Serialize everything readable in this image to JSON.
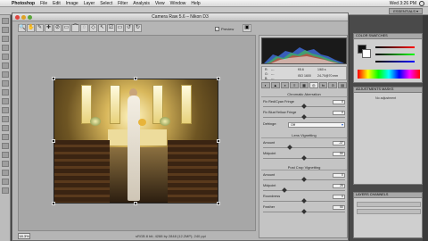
{
  "menubar": {
    "apple_glyph": "",
    "app_name": "Photoshop",
    "items": [
      "File",
      "Edit",
      "Image",
      "Layer",
      "Select",
      "Filter",
      "Analysis",
      "View",
      "Window",
      "Help"
    ],
    "clock": "Wed 3:26 PM"
  },
  "workspace": {
    "essentials_label": "ESSENTIALS ▾"
  },
  "dialog": {
    "title": "Camera Raw 5.6 – Nikon D3",
    "preview_label": "Preview",
    "preview_checked": "✓",
    "zoom_level": "18.3%",
    "status_text": "sRGB 8 bit; 4288 by 2848 (12.2MP); 240 ppi",
    "traffic_colors": [
      "#e0443e",
      "#dea123",
      "#5aa53a"
    ]
  },
  "readout": {
    "r_label": "R:",
    "g_label": "G:",
    "b_label": "B:",
    "r_value": "---",
    "g_value": "---",
    "b_value": "---",
    "f_value": "f/5.6",
    "shutter": "1/60 s",
    "iso": "ISO 1600",
    "focal": "24-70@70 mm"
  },
  "panel_tabs": [
    "◐",
    "▲",
    "◑",
    "≡",
    "▦",
    "◎",
    "fx",
    "⊙",
    "▤"
  ],
  "sections": {
    "chromatic": {
      "title": "Chromatic Aberration",
      "rows": [
        {
          "label": "Fix Red/Cyan Fringe",
          "value": "0",
          "pos": 0.5
        },
        {
          "label": "Fix Blue/Yellow Fringe",
          "value": "0",
          "pos": 0.5
        }
      ],
      "defringe_label": "Defringe:",
      "defringe_value": "Off"
    },
    "lens_vignetting": {
      "title": "Lens Vignetting",
      "rows": [
        {
          "label": "Amount",
          "value": "-37",
          "pos": 0.32
        },
        {
          "label": "Midpoint",
          "value": "50",
          "pos": 0.5
        }
      ]
    },
    "post_crop": {
      "title": "Post Crop Vignetting",
      "rows": [
        {
          "label": "Amount",
          "value": "0",
          "pos": 0.5
        },
        {
          "label": "Midpoint",
          "value": "25",
          "pos": 0.25
        },
        {
          "label": "Roundness",
          "value": "0",
          "pos": 0.5
        },
        {
          "label": "Feather",
          "value": "50",
          "pos": 0.5
        }
      ]
    }
  },
  "ps_panels": {
    "color_tabs": "COLOR   SWATCHES",
    "adjustments_tabs": "ADJUSTMENTS   MASKS",
    "adjustments_msg": "No adjustment",
    "layers_tabs": "LAYERS   CHANNELS"
  },
  "tool_glyphs": [
    "↖",
    "✋",
    "🔍",
    "✚",
    "✎",
    "⌒",
    "▭",
    "◇",
    "⊘",
    "◌",
    "↺",
    "↻",
    "⎚"
  ],
  "panel_icon": "▣"
}
